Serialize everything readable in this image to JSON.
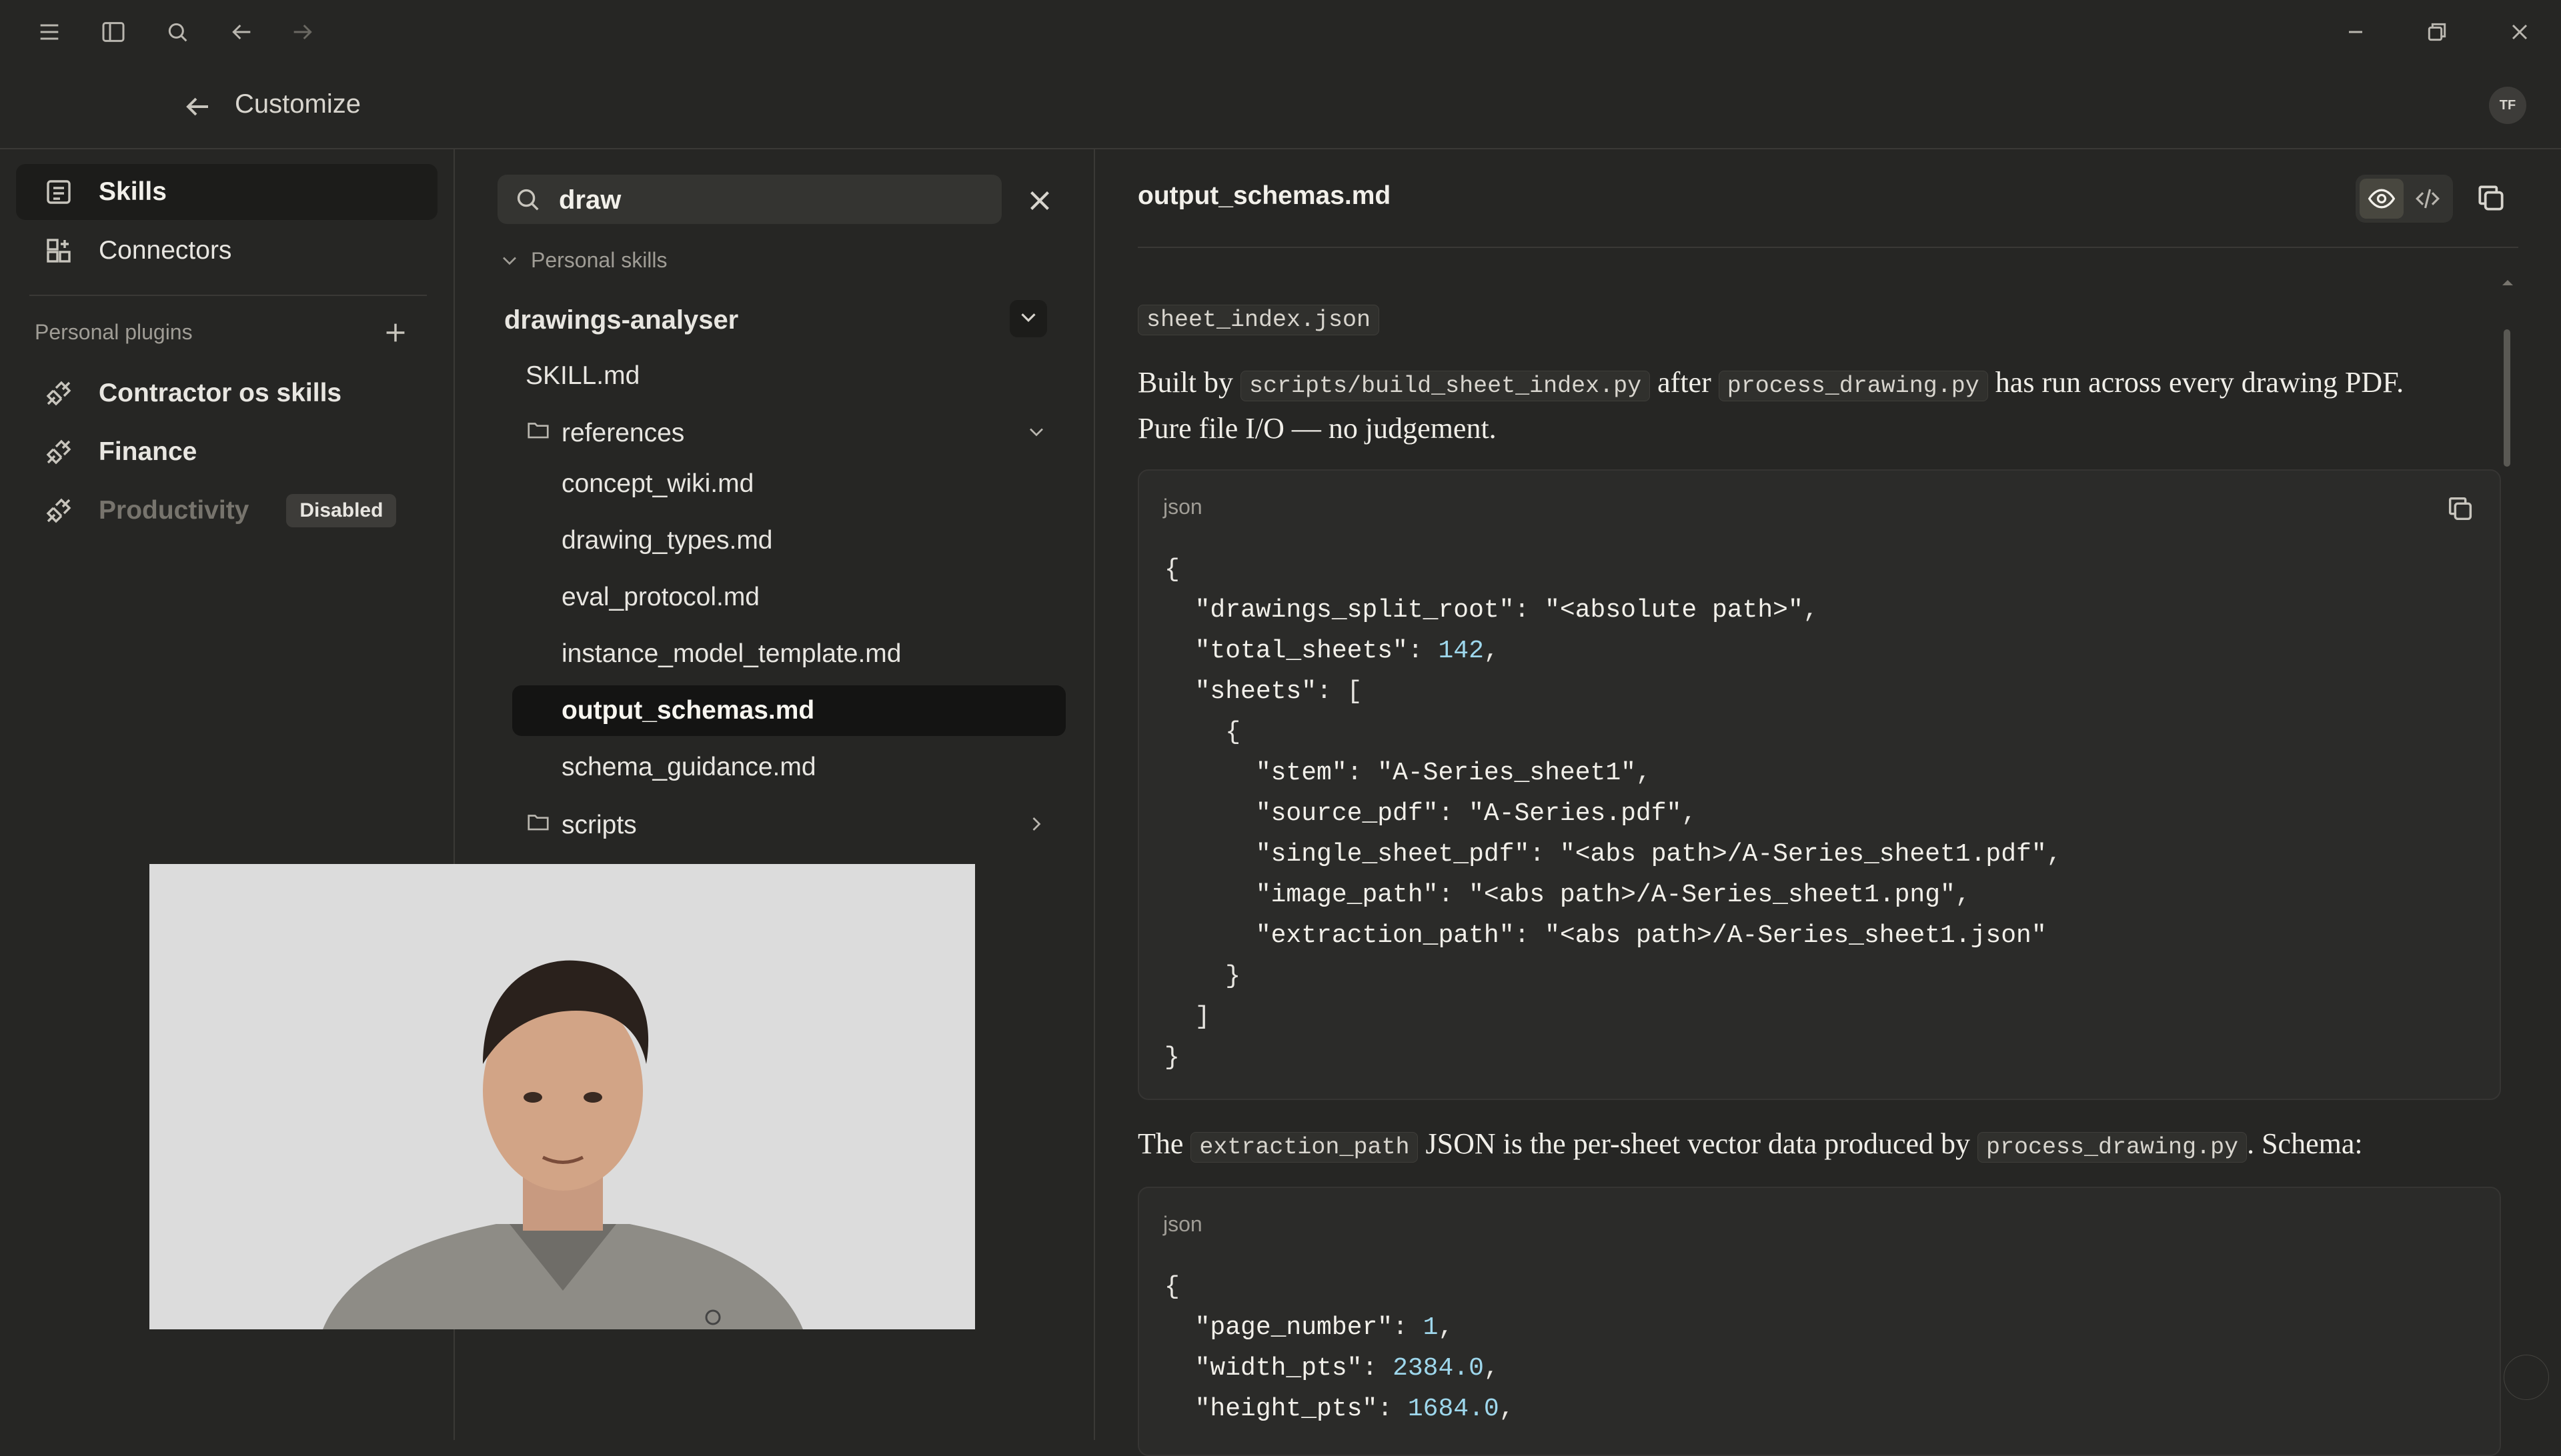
{
  "window": {
    "controls": {
      "minimize": "minimize",
      "restore": "restore",
      "close": "close"
    }
  },
  "header": {
    "title": "Customize",
    "avatar_initials": "TF"
  },
  "sidebar": {
    "items": [
      {
        "label": "Skills",
        "icon": "skills-icon",
        "active": true
      },
      {
        "label": "Connectors",
        "icon": "connectors-icon",
        "active": false
      }
    ],
    "plugins_label": "Personal plugins",
    "plugins": [
      {
        "label": "Contractor os skills",
        "icon": "plug-icon"
      },
      {
        "label": "Finance",
        "icon": "plug-icon"
      },
      {
        "label": "Productivity",
        "icon": "plug-icon",
        "badge": "Disabled"
      }
    ]
  },
  "files": {
    "search_value": "draw",
    "section_label": "Personal skills",
    "skill_name": "drawings-analyser",
    "skill_file": "SKILL.md",
    "folders": [
      {
        "name": "references",
        "files": [
          "concept_wiki.md",
          "drawing_types.md",
          "eval_protocol.md",
          "instance_model_template.md",
          "output_schemas.md",
          "schema_guidance.md"
        ]
      },
      {
        "name": "scripts"
      }
    ],
    "active_file": "output_schemas.md"
  },
  "document": {
    "title": "output_schemas.md",
    "heading_code": "sheet_index.json",
    "para1": {
      "t1": "Built by ",
      "c1": "scripts/build_sheet_index.py",
      "t2": " after ",
      "c2": "process_drawing.py",
      "t3": " has run across every drawing PDF.",
      "line2": "Pure file I/O — no judgement."
    },
    "code1_lang": "json",
    "code1": {
      "l1": "{",
      "k_root": "\"drawings_split_root\"",
      "v_root": "\"<absolute path>\"",
      "k_total": "\"total_sheets\"",
      "v_total": "142",
      "k_sheets": "\"sheets\"",
      "k_stem": "\"stem\"",
      "v_stem": "\"A-Series_sheet1\"",
      "k_src": "\"source_pdf\"",
      "v_src": "\"A-Series.pdf\"",
      "k_single": "\"single_sheet_pdf\"",
      "v_single": "\"<abs path>/A-Series_sheet1.pdf\"",
      "k_img": "\"image_path\"",
      "v_img": "\"<abs path>/A-Series_sheet1.png\"",
      "k_ext": "\"extraction_path\"",
      "v_ext": "\"<abs path>/A-Series_sheet1.json\""
    },
    "para2": {
      "t1": "The ",
      "c1": "extraction_path",
      "t2": " JSON is the per-sheet vector data produced by ",
      "c2": "process_drawing.py",
      "t3": ". Schema:"
    },
    "code2_lang": "json",
    "code2": {
      "k_page": "\"page_number\"",
      "v_page": "1",
      "k_w": "\"width_pts\"",
      "v_w": "2384.0",
      "k_h": "\"height_pts\"",
      "v_h": "1684.0"
    }
  }
}
